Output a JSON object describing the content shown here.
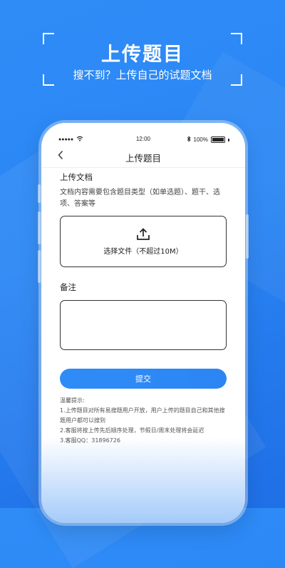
{
  "hero": {
    "title": "上传题目",
    "subtitle": "搜不到？上传自己的试题文档"
  },
  "status_bar": {
    "signal_dots": "●●●●●",
    "wifi_icon": "wifi-icon",
    "time": "12:00",
    "bluetooth_icon": "bluetooth-icon",
    "battery_percent": "100%"
  },
  "navbar": {
    "back_icon": "chevron-left-icon",
    "back_glyph": "‹",
    "title": "上传题目"
  },
  "upload_section": {
    "label": "上传文档",
    "description": "文档内容需要包含题目类型（如单选题）、题干、选项、答案等",
    "upload_icon": "upload-icon",
    "upload_text": "选择文件（不超过10M）"
  },
  "note_section": {
    "label": "备注",
    "value": ""
  },
  "submit": {
    "label": "提交"
  },
  "tips": {
    "heading": "温馨提示:",
    "lines": [
      "1.上传题目对所有易搜题用户开放，用户上传的题目自己和其他搜题用户都可以搜到",
      "2.客服将按上传先后顺序处理，节假日/周末处理将会延迟",
      "3.客服QQ：31896726"
    ]
  },
  "colors": {
    "background_blue": "#2a86f4",
    "button_blue": "#2f8cf7"
  }
}
